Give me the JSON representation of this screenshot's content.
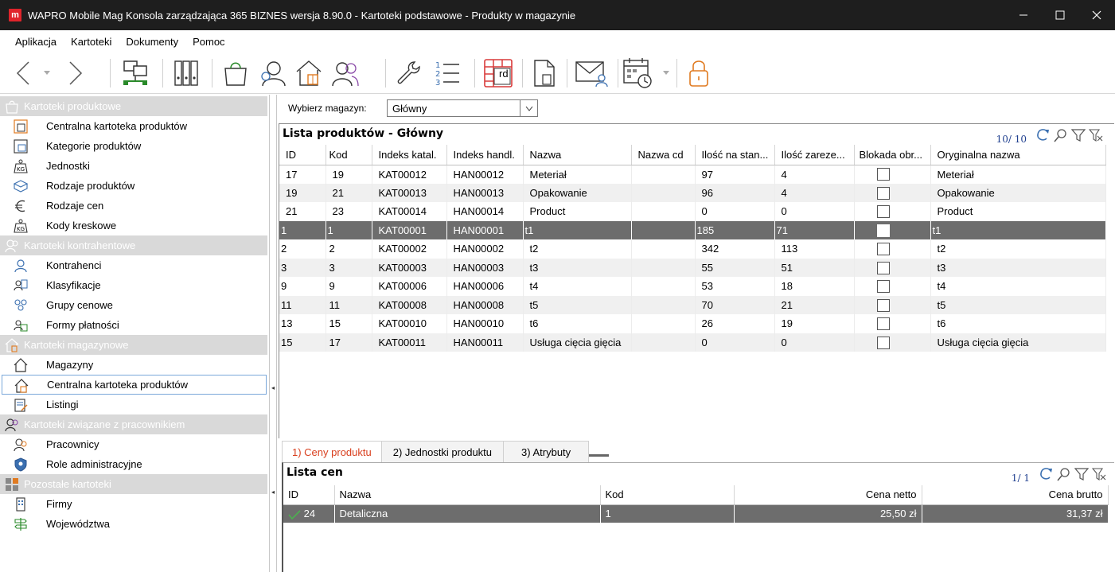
{
  "window": {
    "logo_letter": "m",
    "title": "WAPRO Mobile Mag Konsola zarządzająca 365 BIZNES wersja 8.90.0 - Kartoteki podstawowe - Produkty w magazynie",
    "minimize_glyph": "—",
    "maximize_glyph": "☐",
    "close_glyph": "✕"
  },
  "menu": [
    "Aplikacja",
    "Kartoteki",
    "Dokumenty",
    "Pomoc"
  ],
  "toolbar": {
    "icons": [
      "back-arrow-icon",
      "forward-arrow-icon",
      "network-icon",
      "binders-icon",
      "shopping-bag-icon",
      "person-icon",
      "warehouse-icon",
      "people-icon",
      "wrench-icon",
      "numbered-list-icon",
      "calendar-rd-icon",
      "document-icon",
      "mail-person-icon",
      "calendar-clock-icon",
      "padlock-icon"
    ],
    "rd_label": "rd"
  },
  "sidebar": {
    "groups": [
      {
        "label": "Kartoteki produktowe",
        "items": [
          "Centralna kartoteka produktów",
          "Kategorie produktów",
          "Jednostki",
          "Rodzaje produktów",
          "Rodzaje cen",
          "Kody kreskowe"
        ]
      },
      {
        "label": "Kartoteki kontrahentowe",
        "items": [
          "Kontrahenci",
          "Klasyfikacje",
          "Grupy cenowe",
          "Formy płatności"
        ]
      },
      {
        "label": "Kartoteki magazynowe",
        "items": [
          "Magazyny",
          "Centralna kartoteka produktów",
          "Listingi"
        ]
      },
      {
        "label": "Kartoteki związane z pracownikiem",
        "items": [
          "Pracownicy",
          "Role administracyjne"
        ]
      },
      {
        "label": "Pozostałe kartoteki",
        "items": [
          "Firmy",
          "Województwa"
        ]
      }
    ],
    "selected": "Centralna kartoteka produktów"
  },
  "warehouse": {
    "label": "Wybierz magazyn:",
    "value": "Główny"
  },
  "products": {
    "title": "Lista produktów - Główny",
    "counter": "10/ 10",
    "columns": [
      "ID",
      "Kod",
      "Indeks katal.",
      "Indeks handl.",
      "Nazwa",
      "Nazwa cd",
      "Ilość na stan...",
      "Ilość zareze...",
      "Blokada obr...",
      "Oryginalna nazwa"
    ],
    "rows": [
      [
        "17",
        "19",
        "KAT00012",
        "HAN00012",
        "Meteriał",
        "",
        "97",
        "4",
        "",
        "Meteriał"
      ],
      [
        "19",
        "21",
        "KAT00013",
        "HAN00013",
        "Opakowanie",
        "",
        "96",
        "4",
        "",
        "Opakowanie"
      ],
      [
        "21",
        "23",
        "KAT00014",
        "HAN00014",
        "Product",
        "",
        "0",
        "0",
        "",
        "Product"
      ],
      [
        "1",
        "1",
        "KAT00001",
        "HAN00001",
        "t1",
        "",
        "185",
        "71",
        "",
        "t1"
      ],
      [
        "2",
        "2",
        "KAT00002",
        "HAN00002",
        "t2",
        "",
        "342",
        "113",
        "",
        "t2"
      ],
      [
        "3",
        "3",
        "KAT00003",
        "HAN00003",
        "t3",
        "",
        "55",
        "51",
        "",
        "t3"
      ],
      [
        "9",
        "9",
        "KAT00006",
        "HAN00006",
        "t4",
        "",
        "53",
        "18",
        "",
        "t4"
      ],
      [
        "11",
        "11",
        "KAT00008",
        "HAN00008",
        "t5",
        "",
        "70",
        "21",
        "",
        "t5"
      ],
      [
        "13",
        "15",
        "KAT00010",
        "HAN00010",
        "t6",
        "",
        "26",
        "19",
        "",
        "t6"
      ],
      [
        "15",
        "17",
        "KAT00011",
        "HAN00011",
        "Usługa cięcia gięcia",
        "",
        "0",
        "0",
        "",
        "Usługa cięcia gięcia"
      ]
    ],
    "selected_row": 3
  },
  "tabs": [
    "1) Ceny produktu",
    "2) Jednostki produktu",
    "3) Atrybuty"
  ],
  "prices": {
    "title": "Lista cen",
    "counter": "1/ 1",
    "columns": [
      "ID",
      "Nazwa",
      "Kod",
      "Cena netto",
      "Cena brutto"
    ],
    "rows": [
      [
        "24",
        "Detaliczna",
        "1",
        "25,50 zł",
        "31,37 zł"
      ]
    ]
  },
  "colors": {
    "titlebar": "#1e1e1e",
    "accent_red": "#e0242b",
    "icon_blue": "#3a6fb0",
    "icon_orange": "#e07a20",
    "selection": "#6d6d6d"
  }
}
